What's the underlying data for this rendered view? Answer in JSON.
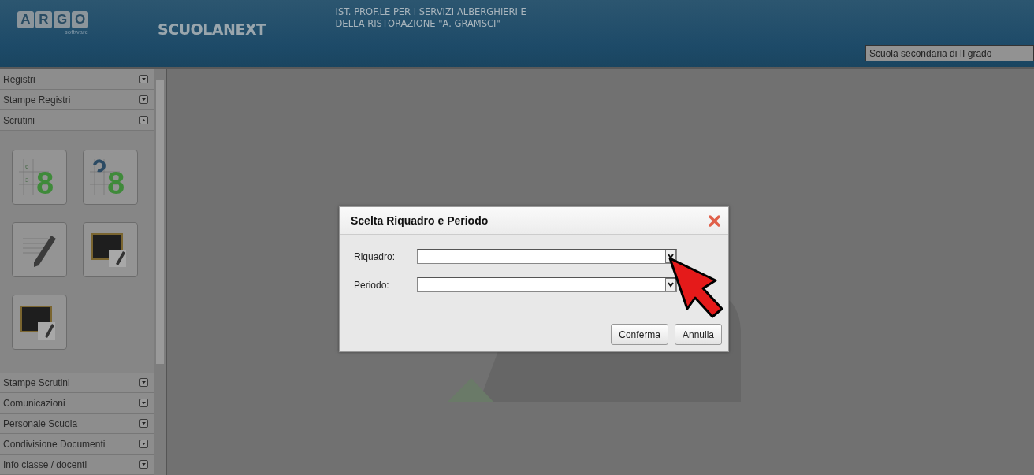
{
  "header": {
    "logo_letters": [
      "A",
      "R",
      "G",
      "O"
    ],
    "logo_caption": "software",
    "app_name": "SCUOLANEXT",
    "school_lines": [
      "IST. PROF.LE PER I SERVIZI ALBERGHIERI E",
      "DELLA RISTORAZIONE \"A. GRAMSCI\""
    ],
    "school_type": "Scuola secondaria di II grado"
  },
  "sidebar": {
    "sections": [
      {
        "label": "Registri",
        "expanded": false
      },
      {
        "label": "Stampe Registri",
        "expanded": false
      },
      {
        "label": "Scrutini",
        "expanded": true,
        "tiles": [
          {
            "kind": "grades",
            "digit": "8",
            "small_digits": [
              "6",
              "3"
            ]
          },
          {
            "kind": "grades-refresh",
            "digit": "8"
          },
          {
            "kind": "notes"
          },
          {
            "kind": "board"
          },
          {
            "kind": "board"
          }
        ]
      },
      {
        "label": "Stampe Scrutini",
        "expanded": false
      },
      {
        "label": "Comunicazioni",
        "expanded": false
      },
      {
        "label": "Personale Scuola",
        "expanded": false
      },
      {
        "label": "Condivisione Documenti",
        "expanded": false
      },
      {
        "label": "Info classe / docenti",
        "expanded": false
      }
    ]
  },
  "dialog": {
    "title": "Scelta Riquadro e Periodo",
    "fields": [
      {
        "label": "Riquadro:"
      },
      {
        "label": "Periodo:"
      }
    ],
    "buttons": [
      "Conferma",
      "Annulla"
    ]
  }
}
